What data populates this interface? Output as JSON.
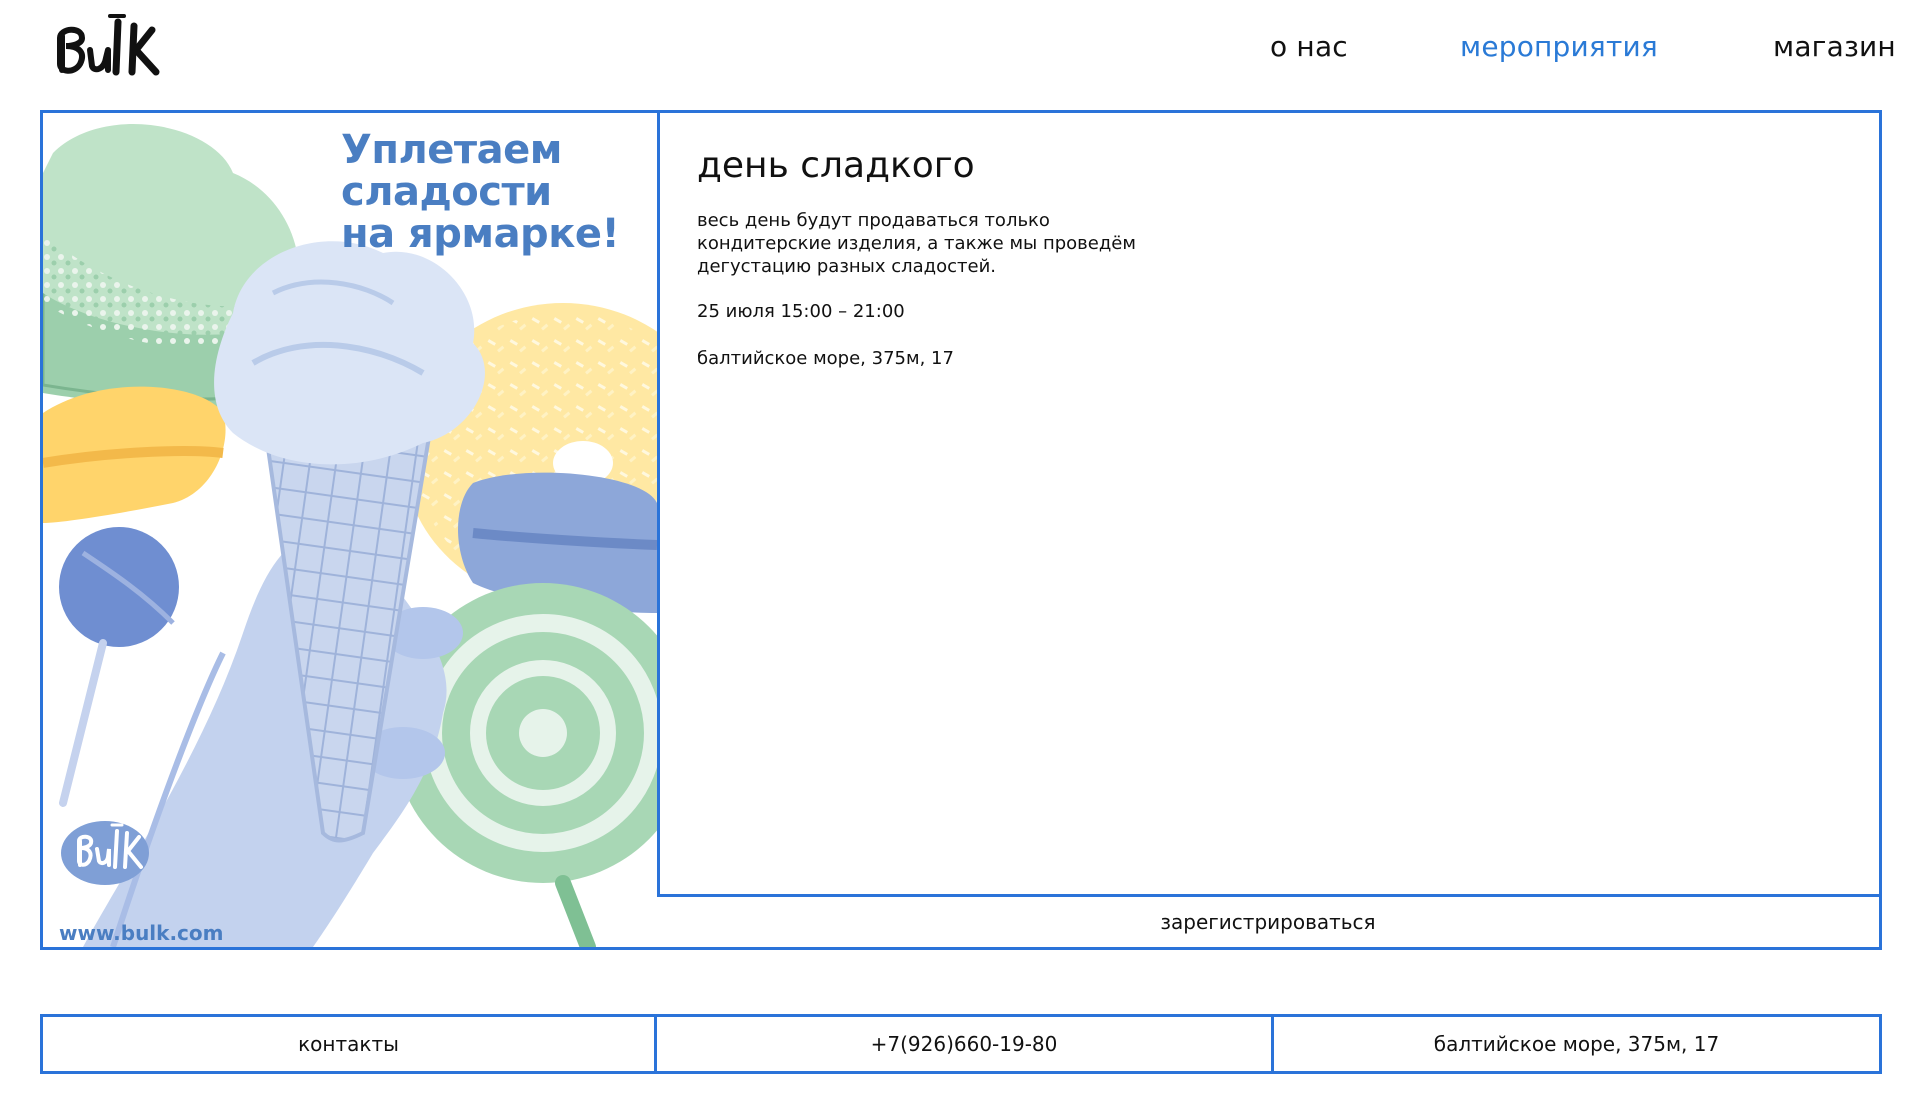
{
  "header": {
    "logo_text": "BulK",
    "nav": [
      {
        "label": "о нас",
        "active": false
      },
      {
        "label": "мероприятия",
        "active": true
      },
      {
        "label": "магазин",
        "active": false
      }
    ]
  },
  "event": {
    "poster": {
      "headline_lines": [
        "Уплетаем",
        "сладости",
        "на ярмарке!"
      ],
      "url": "www.bulk.com",
      "logo_text": "BulK"
    },
    "title": "день сладкого",
    "description": "весь день будут продаваться только кондитерские изделия, а также мы проведём дегустацию разных сладостей.",
    "datetime": "25 июля 15:00 – 21:00",
    "address": "балтийское море, 375м, 17",
    "register_label": "зарегистрироваться"
  },
  "footer": {
    "contacts_label": "контакты",
    "phone": "+7(926)660-19-80",
    "address": "балтийское море, 375м, 17"
  },
  "colors": {
    "accent": "#2a73d9",
    "nav_active": "#2a7ad6",
    "poster_text": "#4a7ec2"
  }
}
